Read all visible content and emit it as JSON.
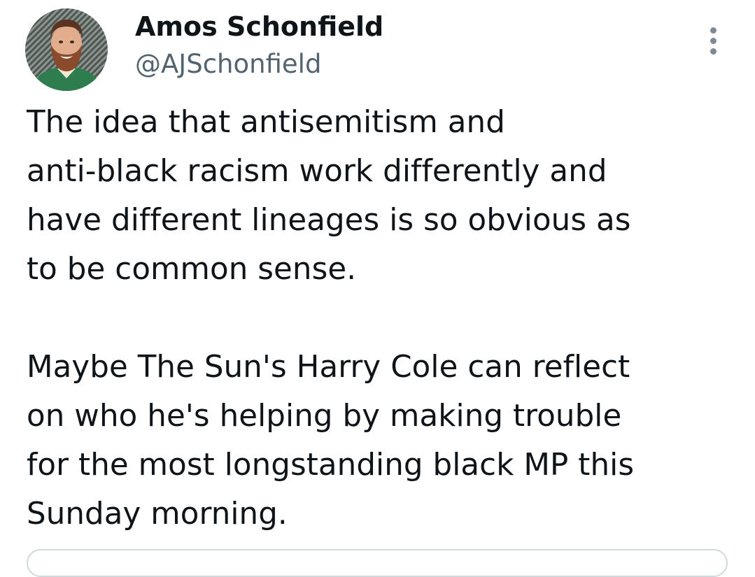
{
  "tweet": {
    "author": {
      "name": "Amos Schonfield",
      "handle": "@AJSchonfield",
      "avatar_icon": "profile-photo"
    },
    "more_icon": "more-vertical-icon",
    "paragraphs": [
      "The idea that antisemitism and\nanti-black racism work differently and\nhave different lineages is so obvious as\nto be common sense.",
      "Maybe The Sun's Harry Cole can reflect\non who he's helping by making trouble\nfor the most longstanding black MP this\nSunday morning."
    ]
  },
  "colors": {
    "text_primary": "#0f1419",
    "text_secondary": "#536471",
    "border": "#cfd9de",
    "avatar_shirt": "#2e7d4f"
  }
}
